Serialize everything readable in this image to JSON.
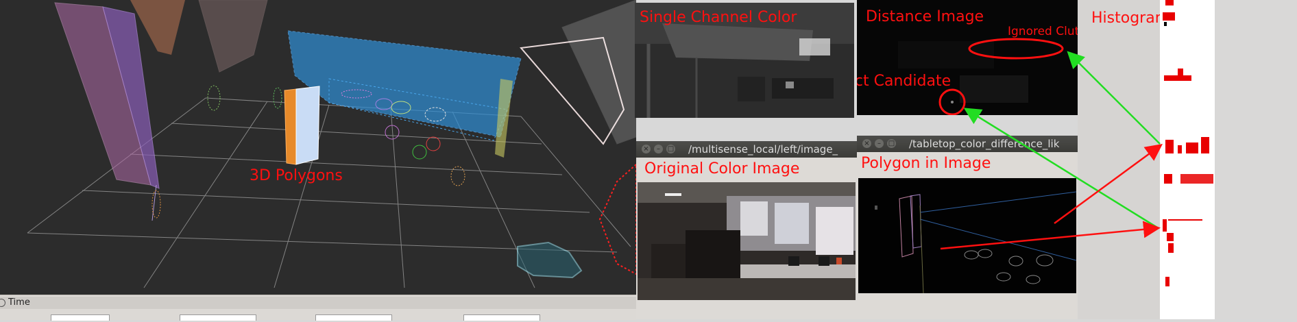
{
  "rviz": {
    "polygons_label": "3D Polygons",
    "time_label": "Time"
  },
  "single_channel": {
    "label": "Single Channel Color"
  },
  "distance": {
    "label": "Distance Image",
    "ignored_label": "Ignored Cluttered Region",
    "candidate_label": "Object Candidate"
  },
  "histograms": {
    "label": "Histograms"
  },
  "original_window": {
    "title": "/multisense_local/left/image_",
    "label": "Original Color Image"
  },
  "polygon_window": {
    "title": "/tabletop_color_difference_lik",
    "label": "Polygon in Image"
  },
  "colors": {
    "annotation": "#ff1010",
    "arrow_green": "#22dd22",
    "arrow_red": "#ff1010",
    "rviz_bg": "#2c2c2c",
    "titlebar": "#3f3f3c"
  }
}
